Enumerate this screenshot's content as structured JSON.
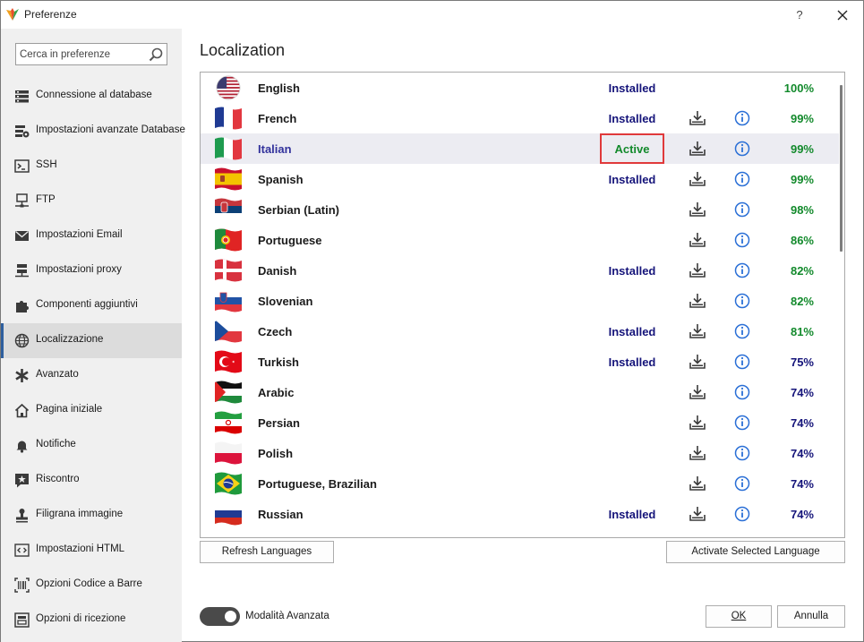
{
  "window": {
    "title": "Preferenze",
    "help_label": "?"
  },
  "search": {
    "placeholder": "Cerca in preferenze",
    "value": ""
  },
  "sidebar": {
    "items": [
      {
        "label": "Connessione al database",
        "icon": "database-server-icon",
        "active": false
      },
      {
        "label": "Impostazioni avanzate Database",
        "icon": "database-settings-icon",
        "active": false
      },
      {
        "label": "SSH",
        "icon": "terminal-icon",
        "active": false
      },
      {
        "label": "FTP",
        "icon": "network-icon",
        "active": false
      },
      {
        "label": "Impostazioni Email",
        "icon": "envelope-icon",
        "active": false
      },
      {
        "label": "Impostazioni proxy",
        "icon": "proxy-icon",
        "active": false
      },
      {
        "label": "Componenti aggiuntivi",
        "icon": "puzzle-icon",
        "active": false
      },
      {
        "label": "Localizzazione",
        "icon": "globe-icon",
        "active": true
      },
      {
        "label": "Avanzato",
        "icon": "asterisk-icon",
        "active": false
      },
      {
        "label": "Pagina iniziale",
        "icon": "home-icon",
        "active": false
      },
      {
        "label": "Notifiche",
        "icon": "bell-icon",
        "active": false
      },
      {
        "label": "Riscontro",
        "icon": "feedback-star-icon",
        "active": false
      },
      {
        "label": "Filigrana immagine",
        "icon": "stamp-icon",
        "active": false
      },
      {
        "label": "Impostazioni HTML",
        "icon": "code-icon",
        "active": false
      },
      {
        "label": "Opzioni Codice a Barre",
        "icon": "barcode-icon",
        "active": false
      },
      {
        "label": "Opzioni di ricezione",
        "icon": "receipt-icon",
        "active": false
      }
    ]
  },
  "main": {
    "title": "Localization",
    "languages": [
      {
        "name": "English",
        "status": "Installed",
        "percent": "100%",
        "flag": "us",
        "color": "#138a2c",
        "download": false,
        "info": false
      },
      {
        "name": "French",
        "status": "Installed",
        "percent": "99%",
        "flag": "fr",
        "color": "#138a2c",
        "download": true,
        "info": true
      },
      {
        "name": "Italian",
        "status": "Active",
        "percent": "99%",
        "flag": "it",
        "color": "#138a2c",
        "download": true,
        "info": true,
        "selected": true
      },
      {
        "name": "Spanish",
        "status": "Installed",
        "percent": "99%",
        "flag": "es",
        "color": "#138a2c",
        "download": true,
        "info": true
      },
      {
        "name": "Serbian (Latin)",
        "status": "",
        "percent": "98%",
        "flag": "rs",
        "color": "#138a2c",
        "download": true,
        "info": true
      },
      {
        "name": "Portuguese",
        "status": "",
        "percent": "86%",
        "flag": "pt",
        "color": "#138a2c",
        "download": true,
        "info": true
      },
      {
        "name": "Danish",
        "status": "Installed",
        "percent": "82%",
        "flag": "dk",
        "color": "#138a2c",
        "download": true,
        "info": true
      },
      {
        "name": "Slovenian",
        "status": "",
        "percent": "82%",
        "flag": "si",
        "color": "#138a2c",
        "download": true,
        "info": true
      },
      {
        "name": "Czech",
        "status": "Installed",
        "percent": "81%",
        "flag": "cz",
        "color": "#138a2c",
        "download": true,
        "info": true
      },
      {
        "name": "Turkish",
        "status": "Installed",
        "percent": "75%",
        "flag": "tr",
        "color": "#15147a",
        "download": true,
        "info": true
      },
      {
        "name": "Arabic",
        "status": "",
        "percent": "74%",
        "flag": "ps",
        "color": "#15147a",
        "download": true,
        "info": true
      },
      {
        "name": "Persian",
        "status": "",
        "percent": "74%",
        "flag": "ir",
        "color": "#15147a",
        "download": true,
        "info": true
      },
      {
        "name": "Polish",
        "status": "",
        "percent": "74%",
        "flag": "pl",
        "color": "#15147a",
        "download": true,
        "info": true
      },
      {
        "name": "Portuguese, Brazilian",
        "status": "",
        "percent": "74%",
        "flag": "br",
        "color": "#15147a",
        "download": true,
        "info": true
      },
      {
        "name": "Russian",
        "status": "Installed",
        "percent": "74%",
        "flag": "ru",
        "color": "#15147a",
        "download": true,
        "info": true
      }
    ],
    "refresh_label": "Refresh Languages",
    "activate_label": "Activate Selected Language"
  },
  "footer": {
    "toggle_label": "Modalità Avanzata",
    "toggle_on": true,
    "ok_label": "OK",
    "cancel_label": "Annulla"
  },
  "colors": {
    "accent": "#2e5f9e",
    "active_status": "#138a2c",
    "installed_status": "#15147a",
    "highlight_border": "#e0393b",
    "info_blue": "#2a6fd6"
  }
}
